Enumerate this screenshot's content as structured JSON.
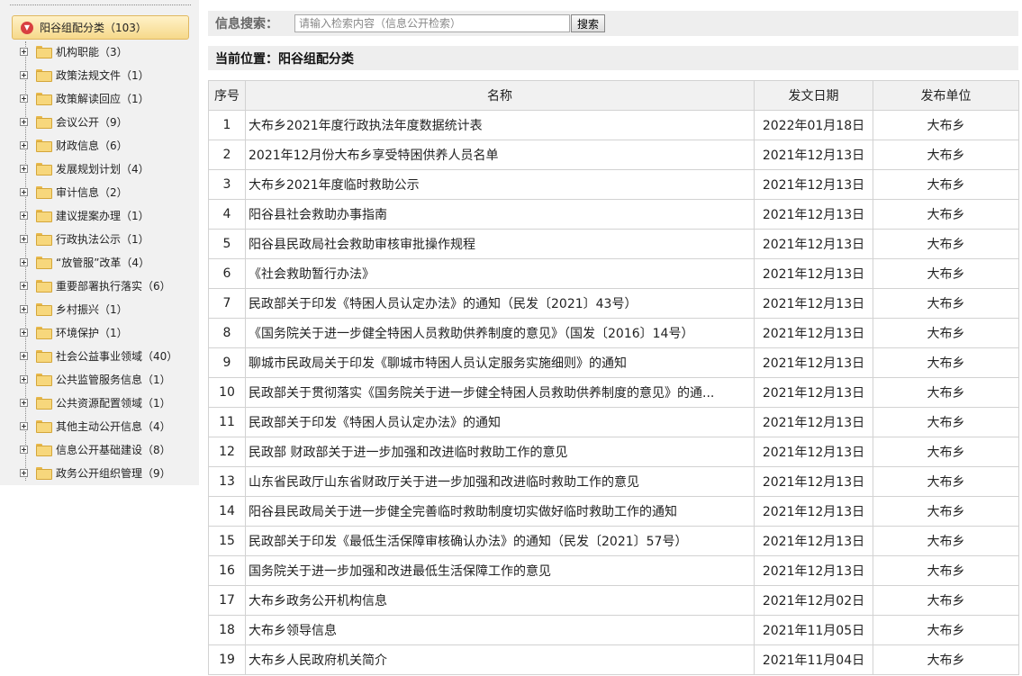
{
  "sidebar": {
    "root_label": "阳谷组配分类（103）",
    "items": [
      {
        "label": "机构职能（3）"
      },
      {
        "label": "政策法规文件（1）"
      },
      {
        "label": "政策解读回应（1）"
      },
      {
        "label": "会议公开（9）"
      },
      {
        "label": "财政信息（6）"
      },
      {
        "label": "发展规划计划（4）"
      },
      {
        "label": "审计信息（2）"
      },
      {
        "label": "建议提案办理（1）"
      },
      {
        "label": "行政执法公示（1）"
      },
      {
        "label": "“放管服”改革（4）"
      },
      {
        "label": "重要部署执行落实（6）"
      },
      {
        "label": "乡村振兴（1）"
      },
      {
        "label": "环境保护（1）"
      },
      {
        "label": "社会公益事业领域（40）"
      },
      {
        "label": "公共监管服务信息（1）"
      },
      {
        "label": "公共资源配置领域（1）"
      },
      {
        "label": "其他主动公开信息（4）"
      },
      {
        "label": "信息公开基础建设（8）"
      },
      {
        "label": "政务公开组织管理（9）"
      }
    ]
  },
  "search": {
    "label": "信息搜索：",
    "placeholder": "请输入检索内容（信息公开检索）",
    "button_label": "搜索"
  },
  "breadcrumb": "当前位置：阳谷组配分类",
  "table": {
    "headers": [
      "序号",
      "名称",
      "发文日期",
      "发布单位"
    ],
    "rows": [
      {
        "no": "1",
        "name": "大布乡2021年度行政执法年度数据统计表",
        "date": "2022年01月18日",
        "unit": "大布乡"
      },
      {
        "no": "2",
        "name": "2021年12月份大布乡享受特困供养人员名单",
        "date": "2021年12月13日",
        "unit": "大布乡"
      },
      {
        "no": "3",
        "name": "大布乡2021年度临时救助公示",
        "date": "2021年12月13日",
        "unit": "大布乡"
      },
      {
        "no": "4",
        "name": "阳谷县社会救助办事指南",
        "date": "2021年12月13日",
        "unit": "大布乡"
      },
      {
        "no": "5",
        "name": "阳谷县民政局社会救助审核审批操作规程",
        "date": "2021年12月13日",
        "unit": "大布乡"
      },
      {
        "no": "6",
        "name": "《社会救助暂行办法》",
        "date": "2021年12月13日",
        "unit": "大布乡"
      },
      {
        "no": "7",
        "name": "民政部关于印发《特困人员认定办法》的通知（民发〔2021〕43号）",
        "date": "2021年12月13日",
        "unit": "大布乡"
      },
      {
        "no": "8",
        "name": "《国务院关于进一步健全特困人员救助供养制度的意见》（国发〔2016〕14号）",
        "date": "2021年12月13日",
        "unit": "大布乡"
      },
      {
        "no": "9",
        "name": "聊城市民政局关于印发《聊城市特困人员认定服务实施细则》的通知",
        "date": "2021年12月13日",
        "unit": "大布乡"
      },
      {
        "no": "10",
        "name": "民政部关于贯彻落实《国务院关于进一步健全特困人员救助供养制度的意见》的通...",
        "date": "2021年12月13日",
        "unit": "大布乡"
      },
      {
        "no": "11",
        "name": "民政部关于印发《特困人员认定办法》的通知",
        "date": "2021年12月13日",
        "unit": "大布乡"
      },
      {
        "no": "12",
        "name": "民政部 财政部关于进一步加强和改进临时救助工作的意见",
        "date": "2021年12月13日",
        "unit": "大布乡"
      },
      {
        "no": "13",
        "name": "山东省民政厅山东省财政厅关于进一步加强和改进临时救助工作的意见",
        "date": "2021年12月13日",
        "unit": "大布乡"
      },
      {
        "no": "14",
        "name": "阳谷县民政局关于进一步健全完善临时救助制度切实做好临时救助工作的通知",
        "date": "2021年12月13日",
        "unit": "大布乡"
      },
      {
        "no": "15",
        "name": "民政部关于印发《最低生活保障审核确认办法》的通知（民发〔2021〕57号）",
        "date": "2021年12月13日",
        "unit": "大布乡"
      },
      {
        "no": "16",
        "name": "国务院关于进一步加强和改进最低生活保障工作的意见",
        "date": "2021年12月13日",
        "unit": "大布乡"
      },
      {
        "no": "17",
        "name": "大布乡政务公开机构信息",
        "date": "2021年12月02日",
        "unit": "大布乡"
      },
      {
        "no": "18",
        "name": "大布乡领导信息",
        "date": "2021年11月05日",
        "unit": "大布乡"
      },
      {
        "no": "19",
        "name": "大布乡人民政府机关简介",
        "date": "2021年11月04日",
        "unit": "大布乡"
      }
    ]
  }
}
